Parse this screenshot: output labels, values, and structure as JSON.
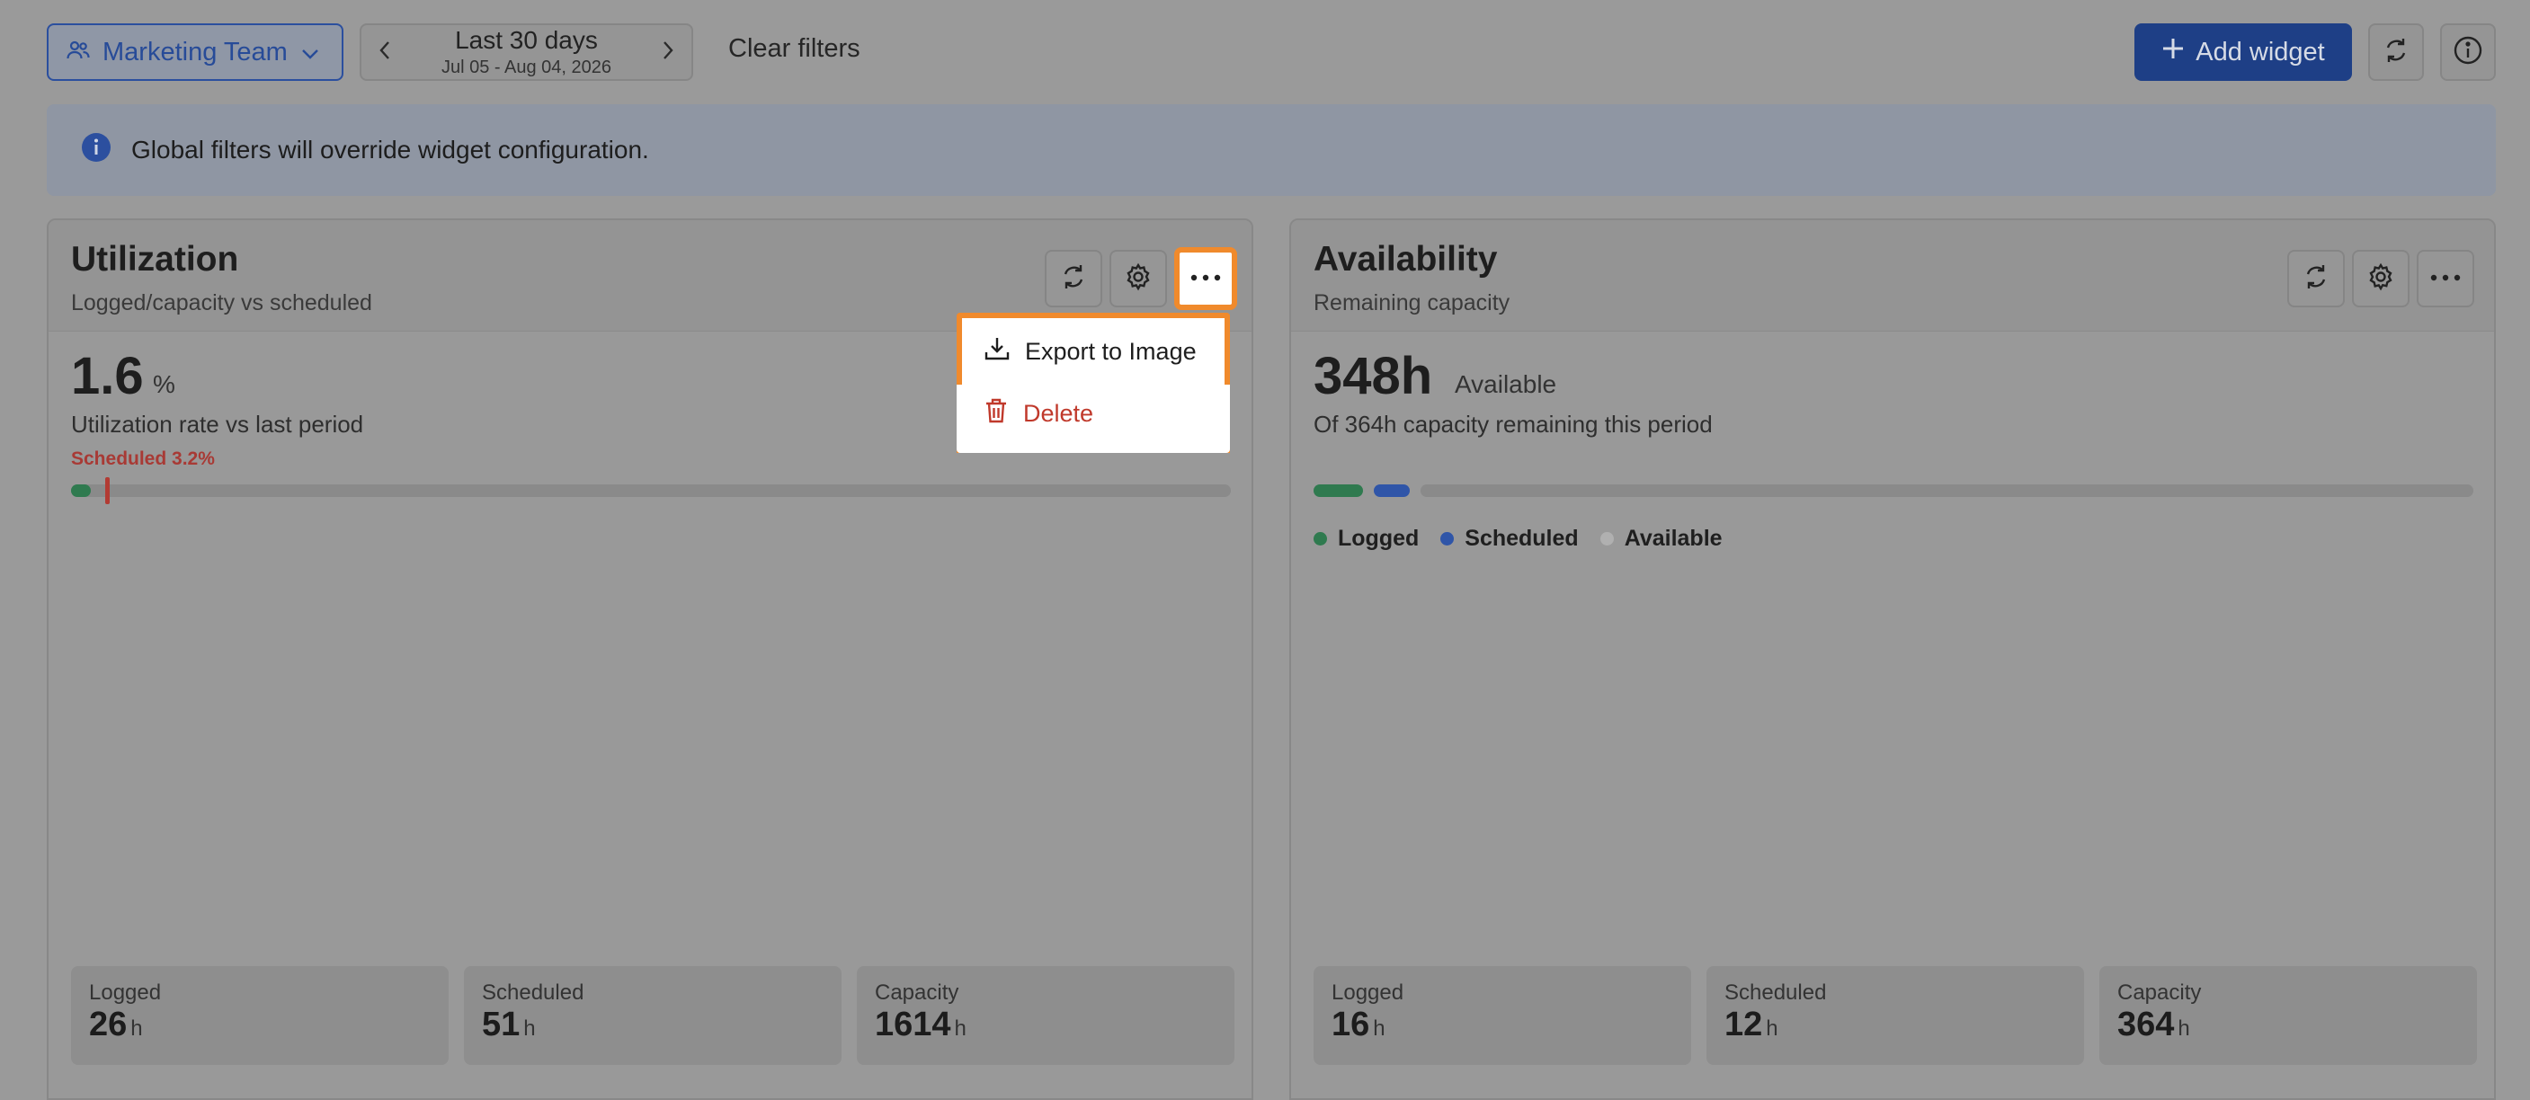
{
  "toolbar": {
    "team_label": "Marketing Team",
    "date_range_title": "Last 30 days",
    "date_range_sub": "Jul 05 - Aug 04, 2026",
    "clear_filters": "Clear filters",
    "add_widget": "Add widget"
  },
  "banner": {
    "text": "Global filters will override widget configuration."
  },
  "widgets": {
    "utilization": {
      "title": "Utilization",
      "subtitle": "Logged/capacity vs scheduled",
      "value": "1.6",
      "unit": "%",
      "description": "Utilization rate vs last period",
      "scheduled_note": "Scheduled 3.2%",
      "stats": [
        {
          "label": "Logged",
          "value": "26",
          "unit": "h"
        },
        {
          "label": "Scheduled",
          "value": "51",
          "unit": "h"
        },
        {
          "label": "Capacity",
          "value": "1614",
          "unit": "h"
        }
      ]
    },
    "availability": {
      "title": "Availability",
      "subtitle": "Remaining capacity",
      "value": "348h",
      "unit": "Available",
      "description": "Of 364h capacity remaining this period",
      "legend": [
        "Logged",
        "Scheduled",
        "Available"
      ],
      "stats": [
        {
          "label": "Logged",
          "value": "16",
          "unit": "h"
        },
        {
          "label": "Scheduled",
          "value": "12",
          "unit": "h"
        },
        {
          "label": "Capacity",
          "value": "364",
          "unit": "h"
        }
      ]
    }
  },
  "menu": {
    "export": "Export to Image",
    "delete": "Delete"
  },
  "colors": {
    "accent": "#1e3f86",
    "highlight": "#f08a2c",
    "logged": "#2f7a4f",
    "scheduled": "#2f55a8",
    "available": "#9c9c9c",
    "danger": "#c0392b"
  }
}
